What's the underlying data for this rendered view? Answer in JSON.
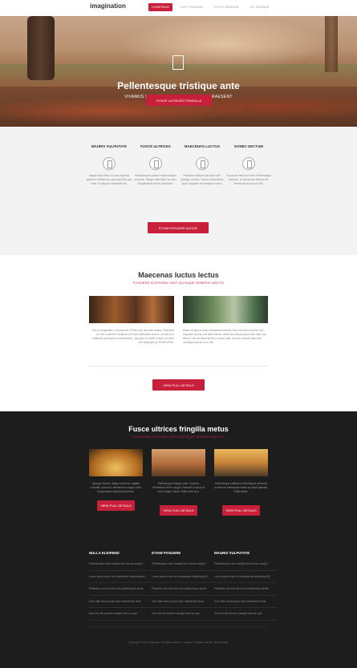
{
  "header": {
    "logo": "imagination",
    "nav": [
      "HOMEPAGE",
      "LEFT SIDEBAR",
      "RIGHT SIDEBAR",
      "NO SIDEBAR"
    ]
  },
  "hero": {
    "title": "Pellentesque tristique ante",
    "subtitle": "VIVAMUS FERMENTUM NIBH IN AUGUE PRAESENT",
    "button": "FUSCE ULTRICES FRINGILLA"
  },
  "features": {
    "items": [
      {
        "title": "MAURIS VULPUTATE",
        "desc": "Integer vitae libero ac risus egestas placerat. Vestibulum commodo felis quis tortor. Ut aliquam sollicitudin leo."
      },
      {
        "title": "FUSCE ULTRICES",
        "desc": "Pellentesque habitant morbi tristique senectus. Integer vitae libero ac risus. Suspendisse dictum sollicitudin."
      },
      {
        "title": "MAECENAS LUCTUS",
        "desc": "Phasellus ultrices nulla quis nibh. Quisque a lectus. Donec consectetuer ligula vulputate sem tristique cursus."
      },
      {
        "title": "DONEC DECTUM",
        "desc": "In posuere felis nec tortor. Pellentesque faucibus. Ut accumsan ultricies elit. Maecenas at justo id velit."
      }
    ],
    "button": "ETIAM POSUERE AUGUE"
  },
  "news": {
    "title": "Maecenas luctus lectus",
    "subtitle": "POSUERE ELEIFEND ODIO QUISQUE SEMPER MATTIS",
    "left_text": "This is Imagination, a responsive HTML5 site template freebie. Released for free under the Creative Commons Attribution license, so use it for whatever (personal or commercial) – just give us credit! Check out more free templates at TEMPLATED.",
    "right_text": "Etiam vel felis at lorem sollicitudin tincidunt. Duis sed odio sit amet nibh vulputate cursus a sit amet mauris. Morbi accumsan ipsum velit. Nam nec tellus a odio tincidunt auctor a ornare odio. Sed non mauris vitae erat consequat auctor eu in elit.",
    "button": "VIEW FULL DETAILS"
  },
  "work": {
    "title": "Fusce ultrices fringilla metus",
    "subtitle": "POSUERE ELEIFEND ODIO QUISQUE SEMPER MATTIS",
    "items": [
      {
        "text": "Quisque dictum. Integer nisl risus, sagittis convallis, rutrum id, elementum congue, nibh. Suspendisse dictum porta lectus.",
        "button": "VIEW FULL DETAILS"
      },
      {
        "text": "Pellentesque tristique ante. Vivamus fermentum nibh in augue. Praesent a lacus at urna congue rutrum. Nulla enim eros.",
        "button": "VIEW FULL DETAILS"
      },
      {
        "text": "Pellentesque habitant morbi tristique senectus et netus et malesuada fames ac turpis egestas. Nulla facilisi.",
        "button": "VIEW FULL DETAILS"
      }
    ]
  },
  "footer": {
    "columns": [
      {
        "heading": "NULLA ELEIFEND",
        "links": [
          "Pellentesque lorem suscipit sed cursus suscipit",
          "Lorem ipsum dolor sit consectetuer adipiscing elit",
          "Phasellus orci sed dolor sed pellentesque ipsum",
          "Duis vitae lorem ipsum dolor blandit felis vitae",
          "Duis nisl elit posuere suscipit rhoncus quis"
        ]
      },
      {
        "heading": "ETIAM POSUERE",
        "links": [
          "Pellentesque lorem suscipit sed cursus suscipit",
          "Lorem ipsum dolor sit consectetuer adipiscing elit",
          "Phasellus orci sed dolor sed pellentesque ipsum",
          "Duis vitae lorem ipsum dolor blandit felis vitae",
          "Duis nisl elit posuere suscipit rhoncus quis"
        ]
      },
      {
        "heading": "MAURIS VULPUTATE",
        "links": [
          "Pellentesque lorem suscipit sed cursus suscipit",
          "Lorem ipsum dolor sit consectetuer adipiscing elit",
          "Phasellus orci sed dolor sed pellentesque ipsum",
          "Duis vitae lorem ipsum dolor blandit felis vitae",
          "Duis nisl elit posuere suscipit rhoncus quis"
        ]
      }
    ],
    "copyright": "Copyright © 2014 Imagination. All rights reserved. | Images: Unsplash | Design: TEMPLATED"
  },
  "colors": {
    "accent": "#c8203a",
    "dark_bg": "#1d1d1d",
    "light_bg": "#f3f3f3"
  }
}
